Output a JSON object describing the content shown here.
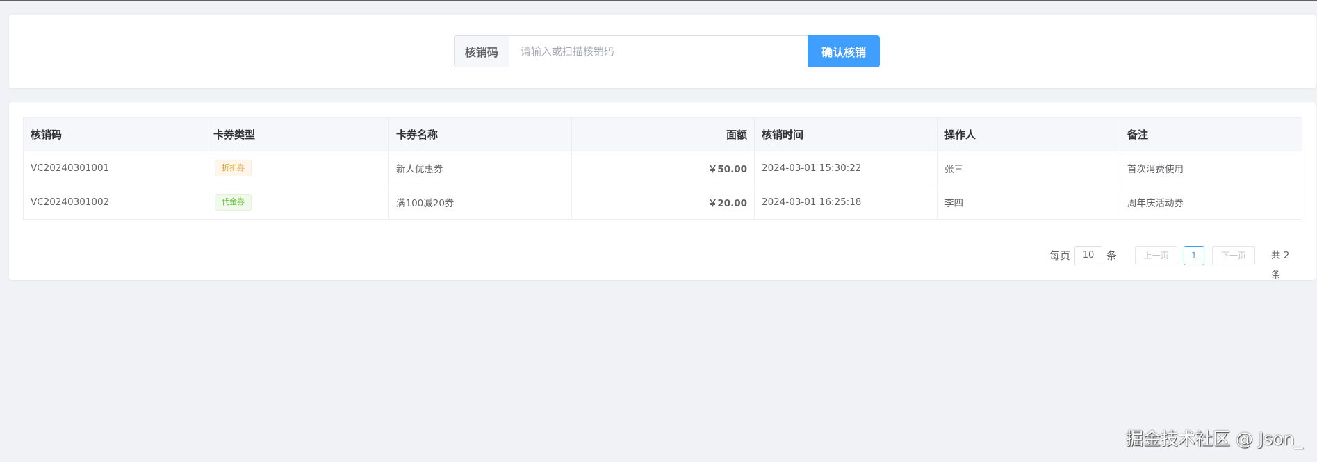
{
  "search": {
    "prefix_label": "核销码",
    "placeholder": "请输入或扫描核销码",
    "value": "",
    "confirm_label": "确认核销"
  },
  "table": {
    "columns": [
      "核销码",
      "卡券类型",
      "卡券名称",
      "面额",
      "核销时间",
      "操作人",
      "备注"
    ],
    "rows": [
      {
        "code": "VC20240301001",
        "type": "折扣券",
        "type_style": "warning",
        "name": "新人优惠券",
        "amount": "￥50.00",
        "time": "2024-03-01 15:30:22",
        "operator": "张三",
        "remark": "首次消费使用"
      },
      {
        "code": "VC20240301002",
        "type": "代金券",
        "type_style": "success",
        "name": "满100减20券",
        "amount": "￥20.00",
        "time": "2024-03-01 16:25:18",
        "operator": "李四",
        "remark": "周年庆活动券"
      }
    ]
  },
  "pagination": {
    "per_page_prefix": "每页",
    "page_size": "10",
    "per_page_suffix": "条",
    "prev_label": "上一页",
    "current_page": "1",
    "next_label": "下一页",
    "total_text": "共 2 条"
  },
  "watermark": "掘金技术社区 @ Json_",
  "colors": {
    "primary": "#409eff",
    "amount": "#f56c6c",
    "tag_warning": "#e6a23c",
    "tag_success": "#67c23a",
    "background": "#f0f2f5"
  }
}
